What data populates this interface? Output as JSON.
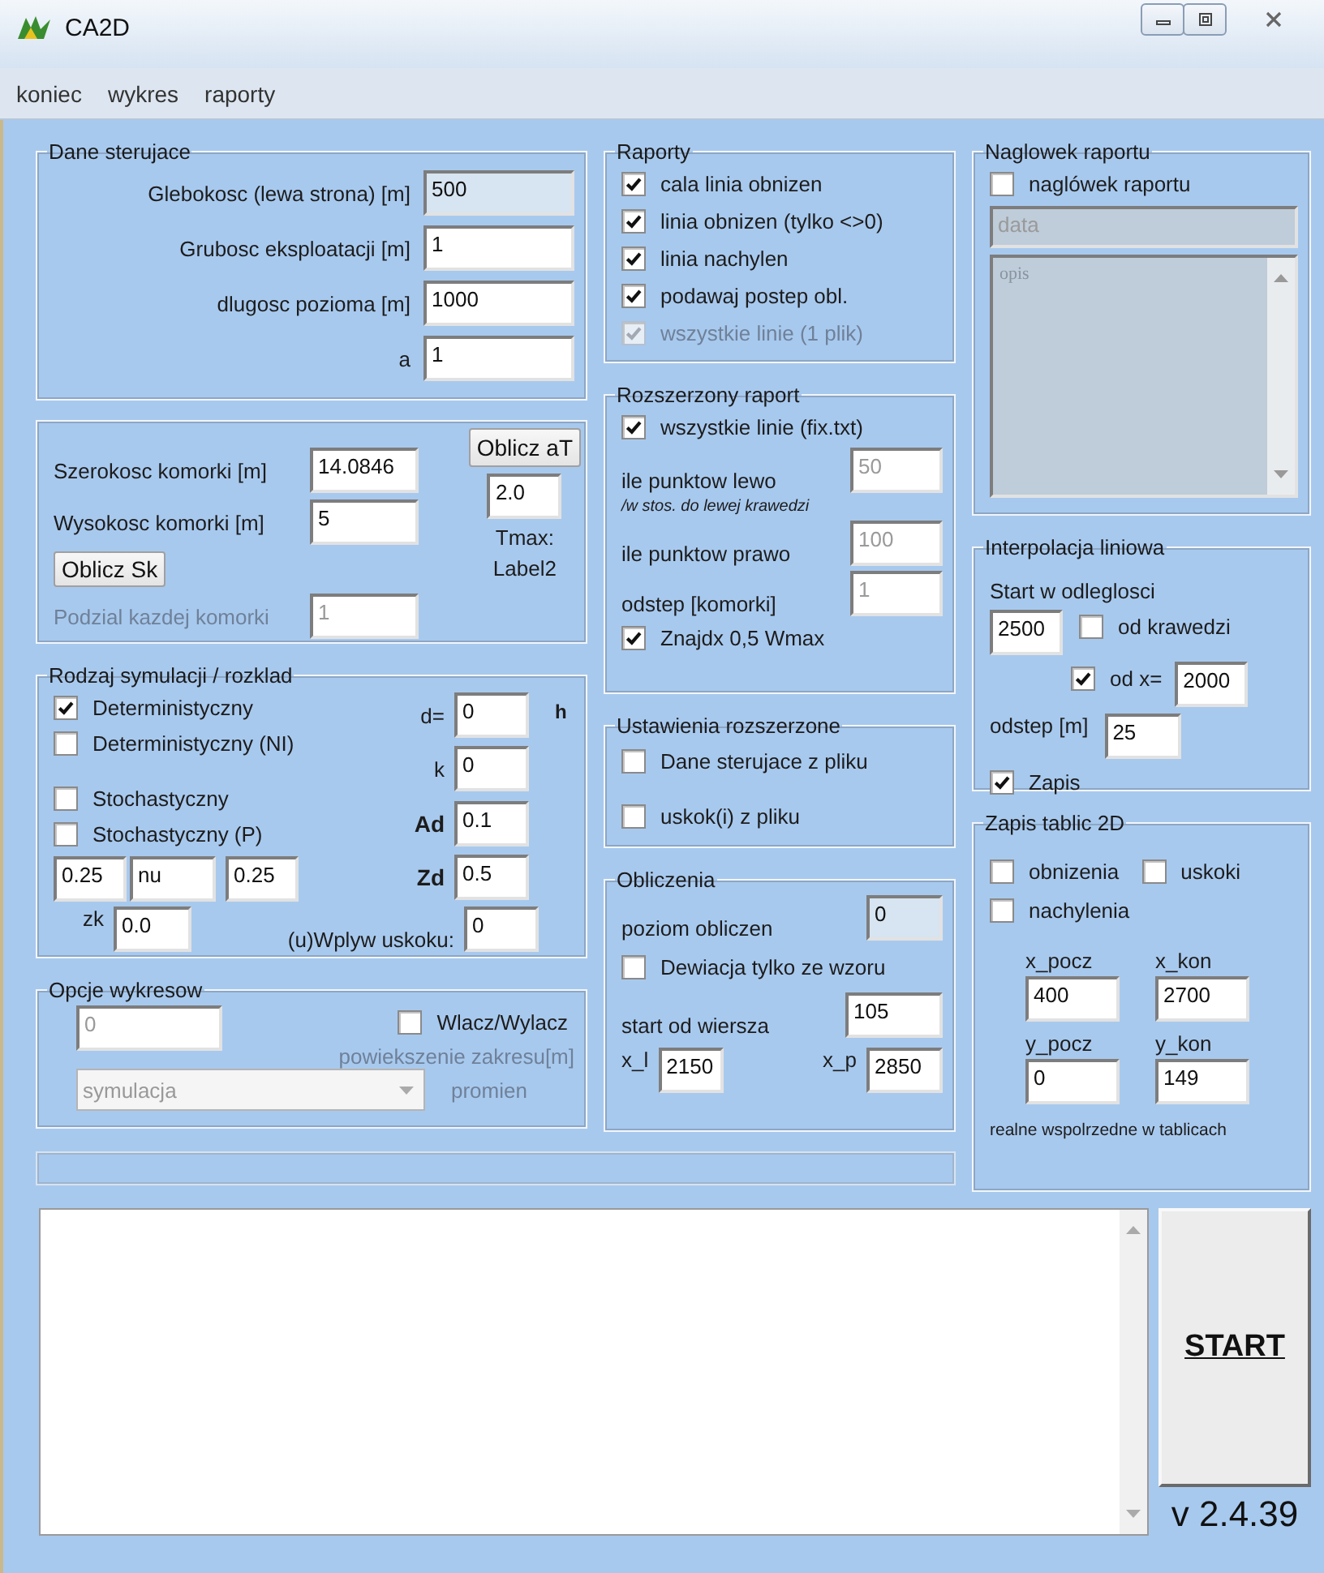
{
  "window": {
    "title": "CA2D"
  },
  "menu": [
    {
      "label": "koniec"
    },
    {
      "label": "wykres"
    },
    {
      "label": "raporty"
    }
  ],
  "dane_sterujace": {
    "title": "Dane sterujace",
    "rows": [
      {
        "label": "Glebokosc (lewa strona) [m]",
        "field": {
          "value": "500",
          "readonly": true,
          "disabled": false
        }
      },
      {
        "label": "Grubosc eksploatacji [m]",
        "field": {
          "value": "1",
          "readonly": false,
          "disabled": false
        }
      },
      {
        "label": "dlugosc pozioma [m]",
        "field": {
          "value": "1000",
          "readonly": false,
          "disabled": false
        }
      },
      {
        "label": "a",
        "field": {
          "value": "1",
          "readonly": false,
          "disabled": false
        }
      }
    ]
  },
  "komorka": {
    "szerokosc": {
      "label": "Szerokosc komorki [m]",
      "field": {
        "value": "14.0846",
        "readonly": false,
        "disabled": false
      }
    },
    "wysokosc": {
      "label": "Wysokosc komorki [m]",
      "field": {
        "value": "5",
        "readonly": false,
        "disabled": false
      }
    },
    "oblicz_sk": "Oblicz Sk",
    "podzial": {
      "label": {
        "text": "Podzial kazdej komorki",
        "disabled": true
      },
      "field": {
        "value": "1",
        "readonly": false,
        "disabled": true
      }
    },
    "oblicz_at": "Oblicz aT",
    "at_field": {
      "value": "2.0",
      "readonly": false,
      "disabled": false
    },
    "tmax": "Tmax:",
    "label2": "Label2"
  },
  "rodzaj": {
    "title": "Rodzaj symulacji / rozklad",
    "options": [
      {
        "label": "Deterministyczny",
        "checked": true,
        "disabled": false
      },
      {
        "label": "Deterministyczny (NI)",
        "checked": false,
        "disabled": false
      },
      {
        "label": "Stochastyczny",
        "checked": false,
        "disabled": false
      },
      {
        "label": "Stochastyczny (P)",
        "checked": false,
        "disabled": false
      }
    ],
    "params": [
      {
        "value": "0.25",
        "readonly": false,
        "disabled": false
      },
      {
        "value": "nu",
        "readonly": false,
        "disabled": false
      },
      {
        "value": "0.25",
        "readonly": false,
        "disabled": false
      }
    ],
    "coeffs": [
      {
        "label": "d=",
        "bold": false,
        "unit": "h",
        "field": {
          "value": "0",
          "readonly": false,
          "disabled": false
        }
      },
      {
        "label": "k",
        "bold": false,
        "field": {
          "value": "0",
          "readonly": false,
          "disabled": false
        }
      },
      {
        "label": "Ad",
        "bold": true,
        "field": {
          "value": "0.1",
          "readonly": false,
          "disabled": false
        }
      },
      {
        "label": "Zd",
        "bold": true,
        "field": {
          "value": "0.5",
          "readonly": false,
          "disabled": false
        }
      }
    ],
    "zk": {
      "label": "zk",
      "field": {
        "value": "0.0",
        "readonly": false,
        "disabled": false
      }
    },
    "wplyw": {
      "label": "(u)Wplyw uskoku:",
      "field": {
        "value": "0",
        "readonly": false,
        "disabled": false
      }
    }
  },
  "opcje": {
    "title": "Opcje wykresow",
    "zakres_field": {
      "value": "0",
      "readonly": false,
      "disabled": true
    },
    "wlacz": {
      "label": "Wlacz/Wylacz",
      "checked": false,
      "disabled": false
    },
    "zakres_label": {
      "text": "powiekszenie zakresu[m]",
      "disabled": true
    },
    "wykres_select": {
      "value": "symulacja",
      "disabled": true
    },
    "promien_label": {
      "text": "promien",
      "disabled": true
    }
  },
  "raporty": {
    "title": "Raporty",
    "items": [
      {
        "label": "cala linia obnizen",
        "checked": true,
        "disabled": false
      },
      {
        "label": "linia obnizen (tylko <>0)",
        "checked": true,
        "disabled": false
      },
      {
        "label": "linia nachylen",
        "checked": true,
        "disabled": false
      },
      {
        "label": "podawaj postep obl.",
        "checked": true,
        "disabled": false
      },
      {
        "label": "wszystkie linie (1 plik)",
        "checked": true,
        "disabled": true
      }
    ]
  },
  "rozszerzony": {
    "title": "Rozszerzony raport",
    "all_lines": {
      "label": "wszystkie linie (fix.txt)",
      "checked": true,
      "disabled": false
    },
    "lewo": {
      "label": "ile punktow lewo",
      "field": {
        "value": "50",
        "readonly": false,
        "disabled": true
      }
    },
    "note": "/w stos. do lewej krawedzi",
    "prawo": {
      "label": "ile punktow prawo",
      "field": {
        "value": "100",
        "readonly": false,
        "disabled": true
      }
    },
    "odstep": {
      "label": "odstep [komorki]",
      "field": {
        "value": "1",
        "readonly": false,
        "disabled": true
      }
    },
    "znajdx": {
      "label": "Znajdx 0,5 Wmax",
      "checked": true,
      "disabled": false
    }
  },
  "ustawienia": {
    "title": "Ustawienia rozszerzone",
    "items": [
      {
        "label": "Dane sterujace z pliku",
        "checked": false,
        "disabled": false
      },
      {
        "label": "uskok(i) z pliku",
        "checked": false,
        "disabled": false
      }
    ]
  },
  "obliczenia": {
    "title": "Obliczenia",
    "poziom": {
      "label": "poziom obliczen",
      "field": {
        "value": "0",
        "readonly": true,
        "disabled": false
      }
    },
    "dewiacja": {
      "label": "Dewiacja tylko ze wzoru",
      "checked": false,
      "disabled": false
    },
    "start": {
      "label": "start od wiersza",
      "field": {
        "value": "105",
        "readonly": false,
        "disabled": false
      }
    },
    "x_l": {
      "label": "x_l",
      "field": {
        "value": "2150",
        "readonly": false,
        "disabled": false
      }
    },
    "x_p": {
      "label": "x_p",
      "field": {
        "value": "2850",
        "readonly": false,
        "disabled": false
      }
    }
  },
  "naglowek": {
    "title": "Naglowek raportu",
    "enable": {
      "label": "naglówek raportu",
      "checked": false,
      "disabled": false
    },
    "data_field": {
      "value": "data",
      "disabled": true
    },
    "opis": {
      "value": "opis",
      "disabled": true
    }
  },
  "interpolacja": {
    "title": "Interpolacja liniowa",
    "start_label": "Start w odleglosci",
    "start_field": {
      "value": "2500",
      "readonly": false,
      "disabled": false
    },
    "od_krawedzi": {
      "label": "od krawedzi",
      "checked": false,
      "disabled": false
    },
    "od_x": {
      "label": "od x=",
      "checked": true,
      "disabled": false
    },
    "od_x_field": {
      "value": "2000",
      "readonly": false,
      "disabled": false
    },
    "odstep": {
      "label": "odstep [m]",
      "field": {
        "value": "25",
        "readonly": false,
        "disabled": false
      }
    },
    "zapis": {
      "label": "Zapis",
      "checked": true,
      "disabled": false
    }
  },
  "zapis2d": {
    "title": "Zapis tablic 2D",
    "options": [
      {
        "label": "obnizenia",
        "checked": false,
        "disabled": false
      },
      {
        "label": "uskoki",
        "checked": false,
        "disabled": false
      },
      {
        "label": "nachylenia",
        "checked": false,
        "disabled": false
      }
    ],
    "coords": [
      {
        "label": "x_pocz",
        "field": {
          "value": "400",
          "readonly": false,
          "disabled": false
        }
      },
      {
        "label": "x_kon",
        "field": {
          "value": "2700",
          "readonly": false,
          "disabled": false
        }
      },
      {
        "label": "y_pocz",
        "field": {
          "value": "0",
          "readonly": false,
          "disabled": false
        }
      },
      {
        "label": "y_kon",
        "field": {
          "value": "149",
          "readonly": false,
          "disabled": false
        }
      }
    ],
    "note": "realne wspolrzedne w tablicach"
  },
  "progress": {
    "level": 0
  },
  "start_button": "START",
  "version": "v 2.4.39"
}
